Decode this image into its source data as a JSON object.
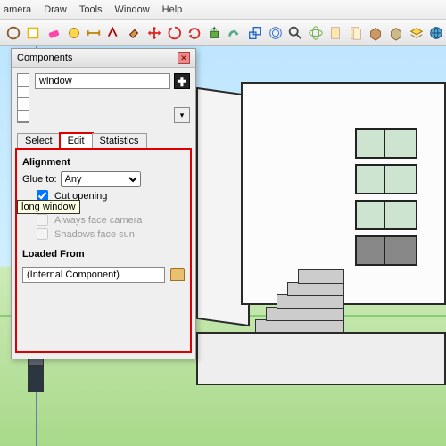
{
  "menu": {
    "items": [
      "amera",
      "Draw",
      "Tools",
      "Window",
      "Help"
    ]
  },
  "panel": {
    "title": "Components",
    "search_value": "window",
    "tabs": [
      "Select",
      "Edit",
      "Statistics"
    ],
    "active_tab": 1,
    "edit": {
      "alignment_heading": "Alignment",
      "glue_label": "Glue to:",
      "glue_value": "Any",
      "cut_opening_label": "Cut opening",
      "cut_opening_checked": true,
      "always_face_label": "Always face camera",
      "always_face_checked": false,
      "shadows_label": "Shadows face sun",
      "shadows_checked": false,
      "tooltip": "long window",
      "loaded_heading": "Loaded From",
      "loaded_value": "(Internal Component)"
    }
  },
  "icons": {
    "circle": "circle",
    "clear": "clear",
    "eraser": "eraser",
    "tape": "tape",
    "dim": "dim",
    "text": "text",
    "paint": "paint",
    "move": "move",
    "rot": "rot",
    "rot2": "rot2",
    "push": "push",
    "follow": "follow",
    "scale": "scale",
    "offset": "offset",
    "nav": "nav",
    "doc": "doc",
    "open": "open",
    "comp1": "comp1",
    "comp2": "comp2",
    "layers": "layers",
    "globe": "globe"
  }
}
